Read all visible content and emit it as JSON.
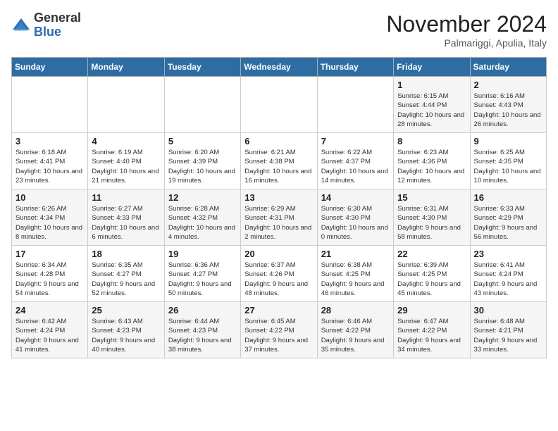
{
  "header": {
    "logo_general": "General",
    "logo_blue": "Blue",
    "month_title": "November 2024",
    "location": "Palmariggi, Apulia, Italy"
  },
  "days_of_week": [
    "Sunday",
    "Monday",
    "Tuesday",
    "Wednesday",
    "Thursday",
    "Friday",
    "Saturday"
  ],
  "weeks": [
    [
      {
        "day": "",
        "info": ""
      },
      {
        "day": "",
        "info": ""
      },
      {
        "day": "",
        "info": ""
      },
      {
        "day": "",
        "info": ""
      },
      {
        "day": "",
        "info": ""
      },
      {
        "day": "1",
        "info": "Sunrise: 6:15 AM\nSunset: 4:44 PM\nDaylight: 10 hours and 28 minutes."
      },
      {
        "day": "2",
        "info": "Sunrise: 6:16 AM\nSunset: 4:43 PM\nDaylight: 10 hours and 26 minutes."
      }
    ],
    [
      {
        "day": "3",
        "info": "Sunrise: 6:18 AM\nSunset: 4:41 PM\nDaylight: 10 hours and 23 minutes."
      },
      {
        "day": "4",
        "info": "Sunrise: 6:19 AM\nSunset: 4:40 PM\nDaylight: 10 hours and 21 minutes."
      },
      {
        "day": "5",
        "info": "Sunrise: 6:20 AM\nSunset: 4:39 PM\nDaylight: 10 hours and 19 minutes."
      },
      {
        "day": "6",
        "info": "Sunrise: 6:21 AM\nSunset: 4:38 PM\nDaylight: 10 hours and 16 minutes."
      },
      {
        "day": "7",
        "info": "Sunrise: 6:22 AM\nSunset: 4:37 PM\nDaylight: 10 hours and 14 minutes."
      },
      {
        "day": "8",
        "info": "Sunrise: 6:23 AM\nSunset: 4:36 PM\nDaylight: 10 hours and 12 minutes."
      },
      {
        "day": "9",
        "info": "Sunrise: 6:25 AM\nSunset: 4:35 PM\nDaylight: 10 hours and 10 minutes."
      }
    ],
    [
      {
        "day": "10",
        "info": "Sunrise: 6:26 AM\nSunset: 4:34 PM\nDaylight: 10 hours and 8 minutes."
      },
      {
        "day": "11",
        "info": "Sunrise: 6:27 AM\nSunset: 4:33 PM\nDaylight: 10 hours and 6 minutes."
      },
      {
        "day": "12",
        "info": "Sunrise: 6:28 AM\nSunset: 4:32 PM\nDaylight: 10 hours and 4 minutes."
      },
      {
        "day": "13",
        "info": "Sunrise: 6:29 AM\nSunset: 4:31 PM\nDaylight: 10 hours and 2 minutes."
      },
      {
        "day": "14",
        "info": "Sunrise: 6:30 AM\nSunset: 4:30 PM\nDaylight: 10 hours and 0 minutes."
      },
      {
        "day": "15",
        "info": "Sunrise: 6:31 AM\nSunset: 4:30 PM\nDaylight: 9 hours and 58 minutes."
      },
      {
        "day": "16",
        "info": "Sunrise: 6:33 AM\nSunset: 4:29 PM\nDaylight: 9 hours and 56 minutes."
      }
    ],
    [
      {
        "day": "17",
        "info": "Sunrise: 6:34 AM\nSunset: 4:28 PM\nDaylight: 9 hours and 54 minutes."
      },
      {
        "day": "18",
        "info": "Sunrise: 6:35 AM\nSunset: 4:27 PM\nDaylight: 9 hours and 52 minutes."
      },
      {
        "day": "19",
        "info": "Sunrise: 6:36 AM\nSunset: 4:27 PM\nDaylight: 9 hours and 50 minutes."
      },
      {
        "day": "20",
        "info": "Sunrise: 6:37 AM\nSunset: 4:26 PM\nDaylight: 9 hours and 48 minutes."
      },
      {
        "day": "21",
        "info": "Sunrise: 6:38 AM\nSunset: 4:25 PM\nDaylight: 9 hours and 46 minutes."
      },
      {
        "day": "22",
        "info": "Sunrise: 6:39 AM\nSunset: 4:25 PM\nDaylight: 9 hours and 45 minutes."
      },
      {
        "day": "23",
        "info": "Sunrise: 6:41 AM\nSunset: 4:24 PM\nDaylight: 9 hours and 43 minutes."
      }
    ],
    [
      {
        "day": "24",
        "info": "Sunrise: 6:42 AM\nSunset: 4:24 PM\nDaylight: 9 hours and 41 minutes."
      },
      {
        "day": "25",
        "info": "Sunrise: 6:43 AM\nSunset: 4:23 PM\nDaylight: 9 hours and 40 minutes."
      },
      {
        "day": "26",
        "info": "Sunrise: 6:44 AM\nSunset: 4:23 PM\nDaylight: 9 hours and 38 minutes."
      },
      {
        "day": "27",
        "info": "Sunrise: 6:45 AM\nSunset: 4:22 PM\nDaylight: 9 hours and 37 minutes."
      },
      {
        "day": "28",
        "info": "Sunrise: 6:46 AM\nSunset: 4:22 PM\nDaylight: 9 hours and 35 minutes."
      },
      {
        "day": "29",
        "info": "Sunrise: 6:47 AM\nSunset: 4:22 PM\nDaylight: 9 hours and 34 minutes."
      },
      {
        "day": "30",
        "info": "Sunrise: 6:48 AM\nSunset: 4:21 PM\nDaylight: 9 hours and 33 minutes."
      }
    ]
  ]
}
